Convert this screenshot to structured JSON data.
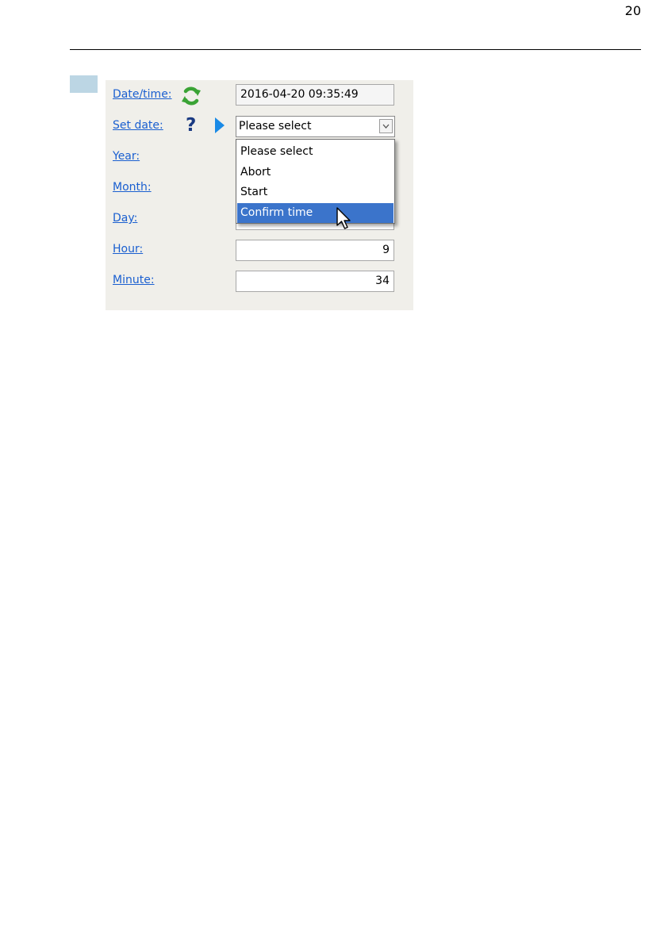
{
  "page": {
    "number": "20"
  },
  "form": {
    "datetime": {
      "label": "Date/time:",
      "value": "2016-04-20 09:35:49"
    },
    "set_date": {
      "label": "Set date:",
      "selected": "Please select",
      "options": [
        "Please select",
        "Abort",
        "Start",
        "Confirm time"
      ],
      "highlighted": "Confirm time"
    },
    "year": {
      "label": "Year:"
    },
    "month": {
      "label": "Month:"
    },
    "day": {
      "label": "Day:"
    },
    "hour": {
      "label": "Hour:",
      "value": "9"
    },
    "minute": {
      "label": "Minute:",
      "value": "34"
    }
  },
  "icons": {
    "refresh": "refresh-icon",
    "help": "?",
    "play": "play-arrow-icon",
    "cursor": "mouse-pointer-icon"
  },
  "colors": {
    "link": "#1a5fd0",
    "panel_bg": "#f0efea",
    "highlight": "#3b74cb",
    "refresh_green": "#3aa335",
    "help_blue": "#1a3a82",
    "play_blue": "#1a8ae6",
    "step_marker": "#bcd6e4"
  }
}
